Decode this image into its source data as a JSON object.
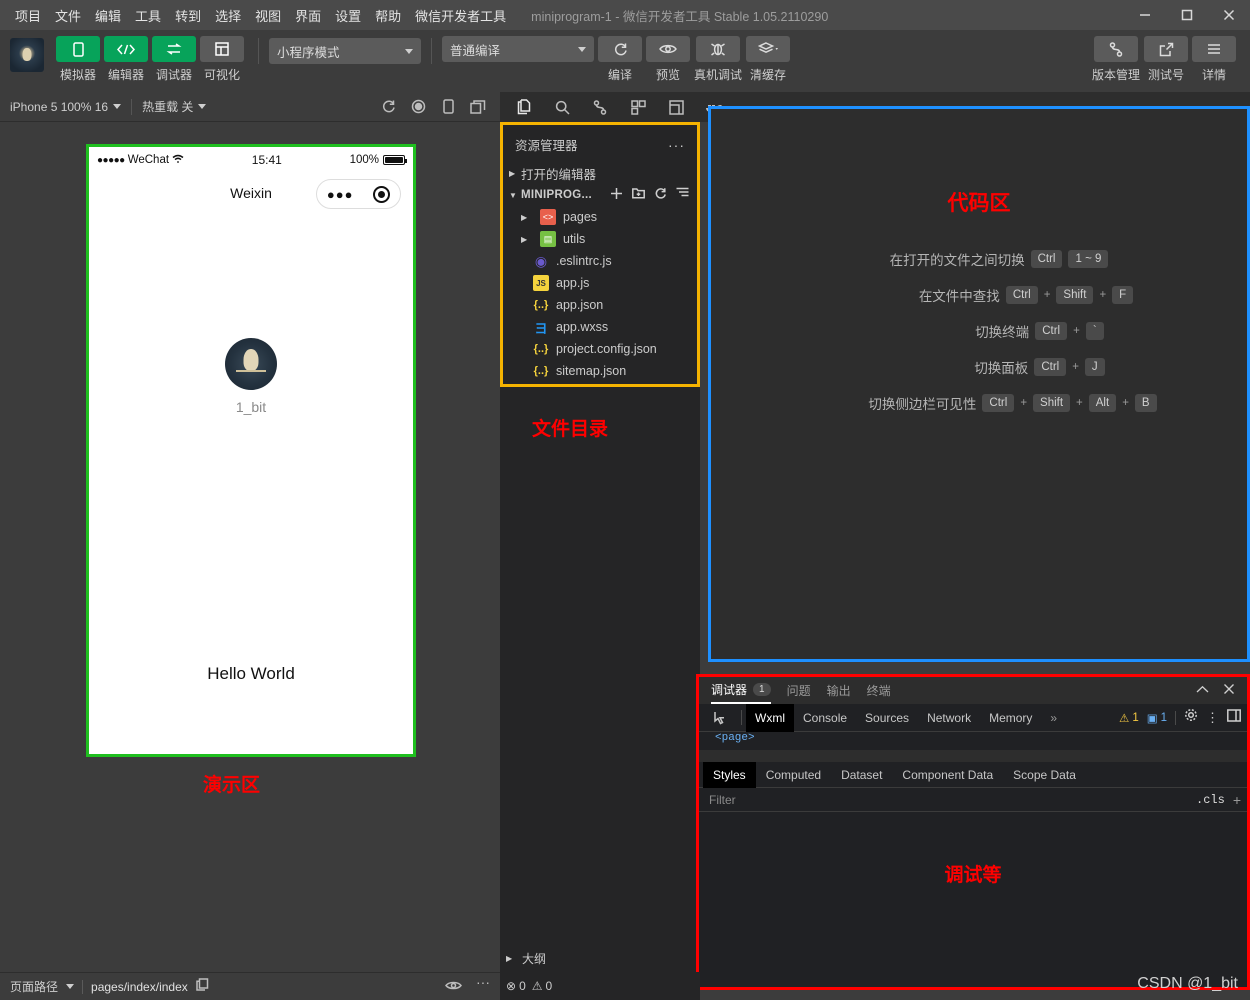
{
  "titlebar": {
    "menu": [
      "项目",
      "文件",
      "编辑",
      "工具",
      "转到",
      "选择",
      "视图",
      "界面",
      "设置",
      "帮助",
      "微信开发者工具"
    ],
    "title": "miniprogram-1 - 微信开发者工具 Stable 1.05.2110290",
    "window_controls": [
      "minimize-icon",
      "maximize-icon",
      "close-icon"
    ]
  },
  "toolbar": {
    "mode_buttons": [
      {
        "label": "模拟器",
        "icon": "phone-icon",
        "style": "green"
      },
      {
        "label": "编辑器",
        "icon": "code-icon",
        "style": "green"
      },
      {
        "label": "调试器",
        "icon": "debug-icon",
        "style": "green"
      },
      {
        "label": "可视化",
        "icon": "layout-icon",
        "style": "grey"
      }
    ],
    "project_mode": "小程序模式",
    "compile_mode": "普通编译",
    "action_buttons": [
      {
        "label": "编译",
        "icon": "refresh-icon"
      },
      {
        "label": "预览",
        "icon": "eye-icon"
      },
      {
        "label": "真机调试",
        "icon": "bug-icon"
      },
      {
        "label": "清缓存",
        "icon": "layers-icon"
      }
    ],
    "right_buttons": [
      {
        "label": "版本管理",
        "icon": "branch-icon"
      },
      {
        "label": "测试号",
        "icon": "external-link-icon"
      },
      {
        "label": "详情",
        "icon": "hamburger-icon"
      }
    ]
  },
  "subbar": {
    "device": "iPhone 5 100% 16",
    "hot_reload": "热重载 关",
    "icons": [
      "refresh-icon",
      "record-icon",
      "phone-icon",
      "window-icon"
    ],
    "activity_icons": [
      "files-icon",
      "search-icon",
      "source-control-icon",
      "extensions-icon",
      "layout-icon",
      "docker-icon"
    ]
  },
  "simulator": {
    "status_bar": {
      "carrier": "WeChat",
      "dots": "●●●●●",
      "wifi": "▲",
      "time": "15:41",
      "battery_pct": "100%"
    },
    "nav_title": "Weixin",
    "capsule": {
      "dots": "●●●",
      "target": "target-icon"
    },
    "username": "1_bit",
    "hello_text": "Hello World",
    "annotation": "演示区"
  },
  "explorer": {
    "header": "资源管理器",
    "more": "···",
    "open_editors": "打开的编辑器",
    "project": "MINIPROG...",
    "project_actions": [
      "new-file-icon",
      "new-folder-icon",
      "refresh-icon",
      "collapse-icon"
    ],
    "items": [
      {
        "name": "pages",
        "type": "folder",
        "icon": "folder-red-icon"
      },
      {
        "name": "utils",
        "type": "folder",
        "icon": "folder-green-icon"
      },
      {
        "name": ".eslintrc.js",
        "type": "file",
        "icon": "eslint-icon"
      },
      {
        "name": "app.js",
        "type": "file",
        "icon": "js-icon"
      },
      {
        "name": "app.json",
        "type": "file",
        "icon": "json-icon"
      },
      {
        "name": "app.wxss",
        "type": "file",
        "icon": "wxss-icon"
      },
      {
        "name": "project.config.json",
        "type": "file",
        "icon": "json-icon"
      },
      {
        "name": "sitemap.json",
        "type": "file",
        "icon": "json-icon"
      }
    ],
    "outline": "大纲",
    "annotation": "文件目录"
  },
  "code_area": {
    "annotation": "代码区",
    "shortcuts": [
      {
        "label": "在打开的文件之间切换",
        "keys": [
          "Ctrl",
          "1 ~ 9"
        ],
        "separators": [
          ""
        ]
      },
      {
        "label": "在文件中查找",
        "keys": [
          "Ctrl",
          "Shift",
          "F"
        ],
        "separators": [
          "+",
          "+"
        ]
      },
      {
        "label": "切换终端",
        "keys": [
          "Ctrl",
          "`"
        ],
        "separators": [
          "+"
        ]
      },
      {
        "label": "切换面板",
        "keys": [
          "Ctrl",
          "J"
        ],
        "separators": [
          "+"
        ]
      },
      {
        "label": "切换侧边栏可见性",
        "keys": [
          "Ctrl",
          "Shift",
          "Alt",
          "B"
        ],
        "separators": [
          "+",
          "+",
          "+"
        ]
      }
    ]
  },
  "debugger": {
    "panel_tabs": [
      {
        "label": "调试器",
        "badge": "1",
        "active": true
      },
      {
        "label": "问题",
        "badge": "",
        "active": false
      },
      {
        "label": "输出",
        "badge": "",
        "active": false
      },
      {
        "label": "终端",
        "badge": "",
        "active": false
      }
    ],
    "window_actions": [
      "collapse-icon",
      "close-icon"
    ],
    "devtools_tabs": [
      "Wxml",
      "Console",
      "Sources",
      "Network",
      "Memory"
    ],
    "devtools_overflow": "»",
    "inspect_icon": "inspect-icon",
    "warning_count": "1",
    "info_count": "1",
    "right_icons": [
      "gear-icon",
      "kebab-icon",
      "dock-icon"
    ],
    "code_snippet": "<page>",
    "style_tabs": [
      "Styles",
      "Computed",
      "Dataset",
      "Component Data",
      "Scope Data"
    ],
    "filter_placeholder": "Filter",
    "cls_label": ".cls",
    "add_label": "+",
    "annotation": "调试等"
  },
  "status_bar": {
    "page_path_label": "页面路径",
    "page_path": "pages/index/index",
    "copy_icon": "copy-icon",
    "eye_icon": "eye-icon",
    "more_icon": "···",
    "errors": "0",
    "warnings": "0",
    "error_icon": "error-circle-icon",
    "warning_icon": "warning-triangle-icon"
  },
  "watermark": "CSDN @1_bit",
  "colors": {
    "simulator_box": "#1fbf1f",
    "explorer_box": "#f5b301",
    "code_box": "#1e90ff",
    "debugger_box": "#ff0000",
    "annotation": "#ff0000",
    "accent_green": "#07a35a"
  }
}
